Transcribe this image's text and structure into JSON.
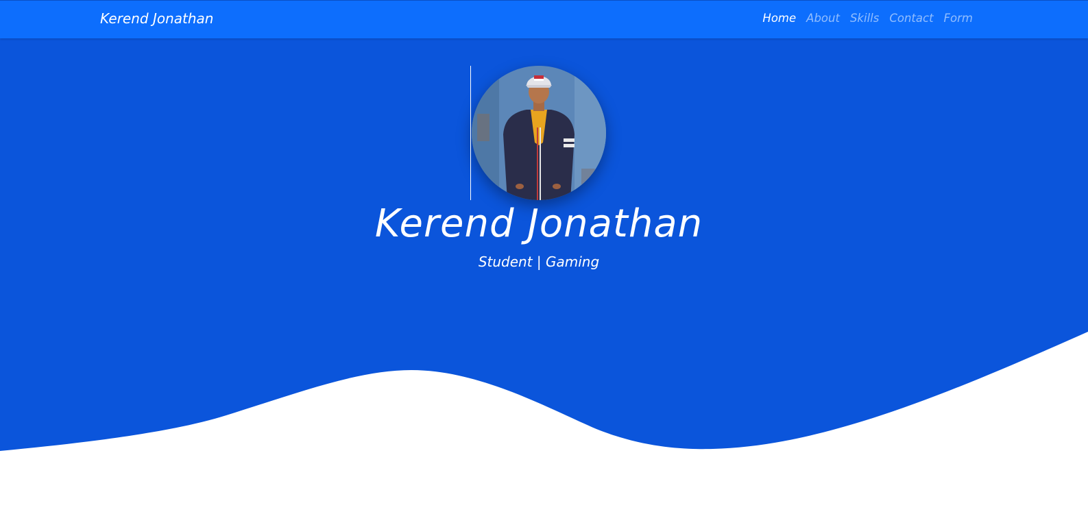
{
  "navbar": {
    "brand": "Kerend Jonathan",
    "links": [
      {
        "label": "Home",
        "active": true
      },
      {
        "label": "About",
        "active": false
      },
      {
        "label": "Skills",
        "active": false
      },
      {
        "label": "Contact",
        "active": false
      },
      {
        "label": "Form",
        "active": false
      }
    ]
  },
  "hero": {
    "name": "Kerend Jonathan",
    "subtitle": "Student | Gaming",
    "avatar_icon": "profile-photo"
  },
  "colors": {
    "navbar": "#0d6efd",
    "hero": "#0b55db",
    "text": "#ffffff",
    "nav_inactive": "rgba(255,255,255,0.55)",
    "page_bg": "#ffffff"
  }
}
